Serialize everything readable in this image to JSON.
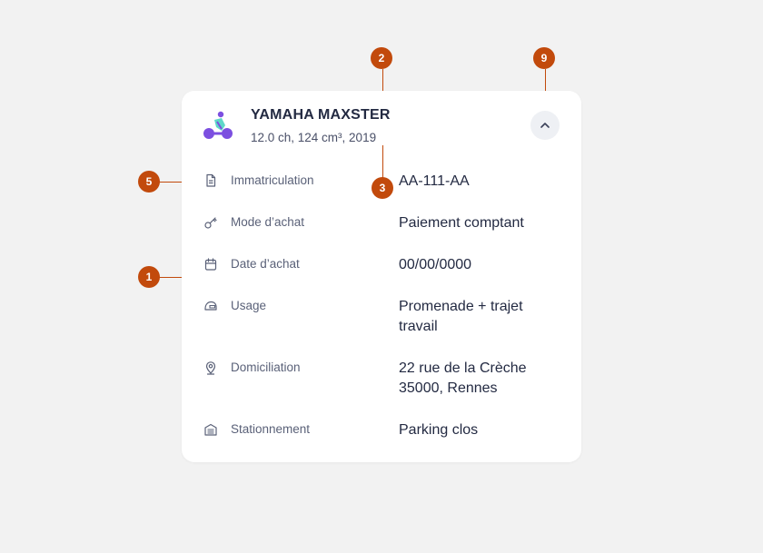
{
  "vehicle": {
    "name": "YAMAHA MAXSTER",
    "specs": "12.0 ch, 124 cm³, 2019",
    "icon": "scooter-icon"
  },
  "colors": {
    "marker": "#c24a0c",
    "vehicle_purple": "#7c4fe0",
    "vehicle_teal": "#5ed7c8"
  },
  "details": [
    {
      "key": "registration",
      "icon": "document-icon",
      "label": "Immatriculation",
      "value": "AA-111-AA"
    },
    {
      "key": "purchase-mode",
      "icon": "key-icon",
      "label": "Mode d’achat",
      "value": "Paiement comptant"
    },
    {
      "key": "purchase-date",
      "icon": "calendar-icon",
      "label": "Date d’achat",
      "value": "00/00/0000"
    },
    {
      "key": "usage",
      "icon": "helmet-icon",
      "label": "Usage",
      "value": "Promenade + trajet travail"
    },
    {
      "key": "domiciliation",
      "icon": "location-pin-icon",
      "label": "Domiciliation",
      "value": "22 rue de la Crèche 35000, Rennes"
    },
    {
      "key": "parking",
      "icon": "garage-icon",
      "label": "Stationnement",
      "value": "Parking clos"
    }
  ],
  "annotations": [
    "2",
    "9",
    "5",
    "3",
    "1"
  ]
}
